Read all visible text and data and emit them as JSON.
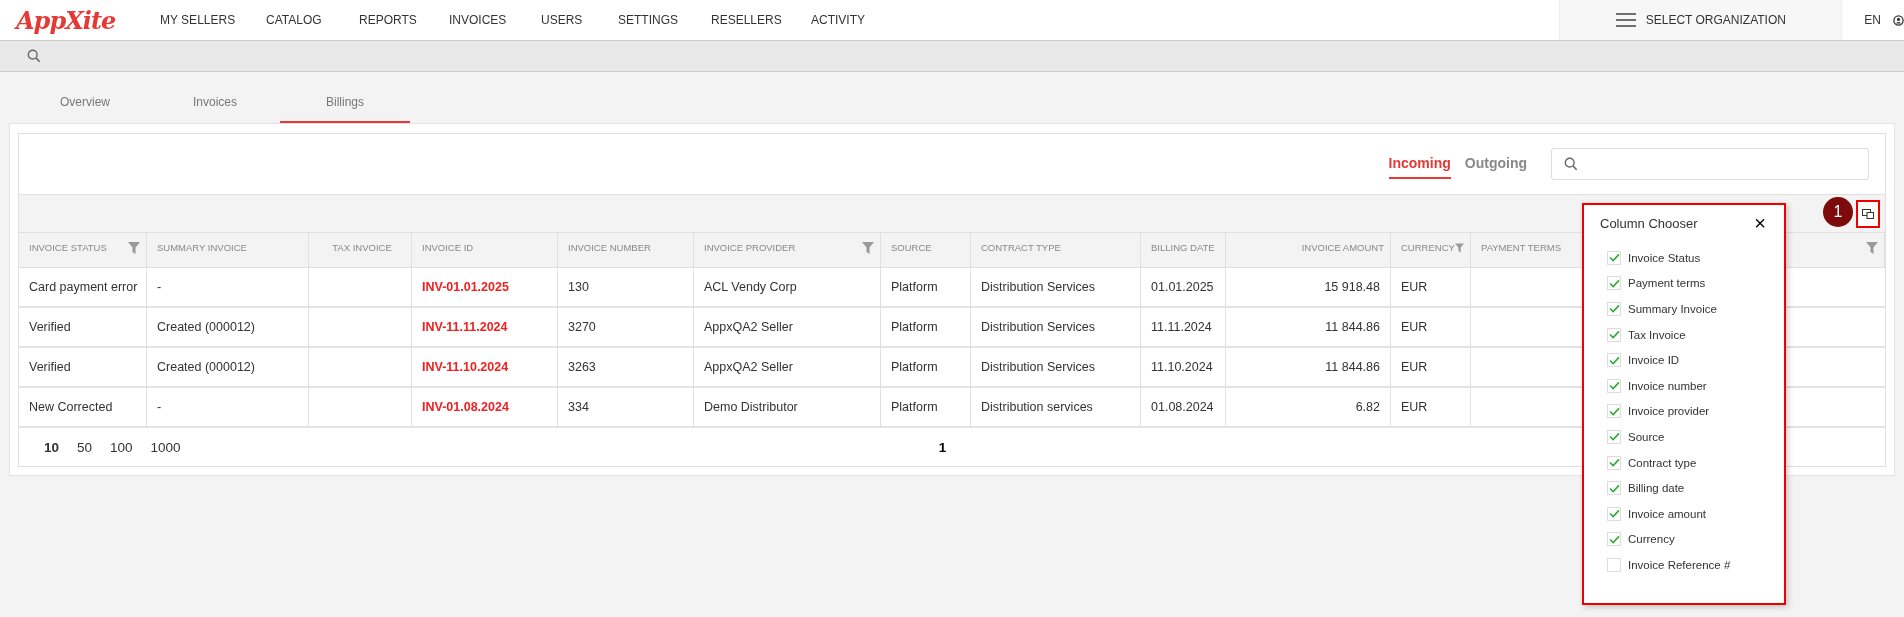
{
  "logo": "AppXite",
  "nav": [
    {
      "label": "MY SELLERS"
    },
    {
      "label": "CATALOG"
    },
    {
      "label": "REPORTS"
    },
    {
      "label": "INVOICES"
    },
    {
      "label": "USERS"
    },
    {
      "label": "SETTINGS"
    },
    {
      "label": "RESELLERS"
    },
    {
      "label": "ACTIVITY"
    }
  ],
  "org_selector": "SELECT ORGANIZATION",
  "language": "EN",
  "tabs": [
    {
      "label": "Overview",
      "selected": false
    },
    {
      "label": "Invoices",
      "selected": false
    },
    {
      "label": "Billings",
      "selected": true
    }
  ],
  "direction_tabs": [
    {
      "label": "Incoming",
      "selected": true
    },
    {
      "label": "Outgoing",
      "selected": false
    }
  ],
  "table": {
    "columns": [
      {
        "label": "INVOICE STATUS",
        "filter": true,
        "kind": "text"
      },
      {
        "label": "SUMMARY INVOICE",
        "filter": false,
        "kind": "text"
      },
      {
        "label": "TAX INVOICE",
        "filter": false,
        "kind": "center"
      },
      {
        "label": "INVOICE ID",
        "filter": false,
        "kind": "link"
      },
      {
        "label": "INVOICE NUMBER",
        "filter": false,
        "kind": "text"
      },
      {
        "label": "INVOICE PROVIDER",
        "filter": true,
        "kind": "text"
      },
      {
        "label": "SOURCE",
        "filter": false,
        "kind": "text"
      },
      {
        "label": "CONTRACT TYPE",
        "filter": false,
        "kind": "text"
      },
      {
        "label": "BILLING DATE",
        "filter": false,
        "kind": "text"
      },
      {
        "label": "INVOICE AMOUNT",
        "filter": false,
        "kind": "amount"
      },
      {
        "label": "CURRENCY",
        "filter": true,
        "kind": "text"
      },
      {
        "label": "PAYMENT TERMS",
        "filter": true,
        "kind": "text"
      }
    ],
    "rows": [
      {
        "cells": [
          "Card payment error",
          "-",
          null,
          "INV-01.01.2025",
          "130",
          "ACL Vendy Corp",
          "Platform",
          "Distribution Services",
          "01.01.2025",
          "15 918.48",
          "EUR",
          null
        ]
      },
      {
        "cells": [
          "Verified",
          "Created (000012)",
          null,
          "INV-11.11.2024",
          "3270",
          "AppxQA2 Seller",
          "Platform",
          "Distribution Services",
          "11.11.2024",
          "11 844.86",
          "EUR",
          null
        ]
      },
      {
        "cells": [
          "Verified",
          "Created (000012)",
          null,
          "INV-11.10.2024",
          "3263",
          "AppxQA2 Seller",
          "Platform",
          "Distribution Services",
          "11.10.2024",
          "11 844.86",
          "EUR",
          null
        ]
      },
      {
        "cells": [
          "New Corrected",
          "-",
          null,
          "INV-01.08.2024",
          "334",
          "Demo Distributor",
          "Platform",
          "Distribution services",
          "01.08.2024",
          "6.82",
          "EUR",
          null
        ]
      }
    ]
  },
  "page_sizes": [
    {
      "label": "10",
      "selected": true
    },
    {
      "label": "50",
      "selected": false
    },
    {
      "label": "100",
      "selected": false
    },
    {
      "label": "1000",
      "selected": false
    }
  ],
  "pages": [
    {
      "label": "1",
      "selected": true
    }
  ],
  "step_badge": "1",
  "column_chooser": {
    "title": "Column Chooser",
    "close": "×",
    "items": [
      {
        "label": "Invoice Status",
        "checked": true
      },
      {
        "label": "Payment terms",
        "checked": true
      },
      {
        "label": "Summary Invoice",
        "checked": true
      },
      {
        "label": "Tax Invoice",
        "checked": true
      },
      {
        "label": "Invoice ID",
        "checked": true
      },
      {
        "label": "Invoice number",
        "checked": true
      },
      {
        "label": "Invoice provider",
        "checked": true
      },
      {
        "label": "Source",
        "checked": true
      },
      {
        "label": "Contract type",
        "checked": true
      },
      {
        "label": "Billing date",
        "checked": true
      },
      {
        "label": "Invoice amount",
        "checked": true
      },
      {
        "label": "Currency",
        "checked": true
      },
      {
        "label": "Invoice Reference #",
        "checked": false
      }
    ]
  }
}
